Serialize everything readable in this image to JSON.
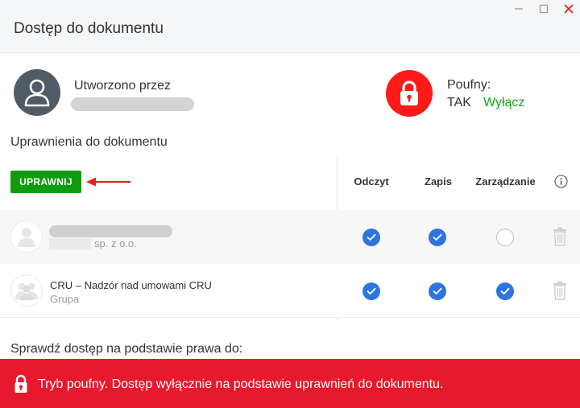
{
  "window": {
    "title": "Dostęp do dokumentu"
  },
  "creator": {
    "label": "Utworzono przez"
  },
  "confidential": {
    "label": "Poufny:",
    "value": "TAK",
    "toggle_label": "Wyłącz"
  },
  "permissions": {
    "section_title": "Uprawnienia do dokumentu",
    "grant_button": "UPRAWNIJ",
    "columns": [
      "Odczyt",
      "Zapis",
      "Zarządzanie"
    ],
    "rows": [
      {
        "subtitle": "sp. z o.o.",
        "read": true,
        "write": true,
        "manage": false
      },
      {
        "name": "CRU – Nadzór nad umowami CRU",
        "subtitle": "Grupa",
        "read": true,
        "write": true,
        "manage": true
      }
    ]
  },
  "check_access": {
    "label": "Sprawdź dostęp na podstawie prawa do:"
  },
  "banner": {
    "text": "Tryb poufny. Dostęp wyłącznie na podstawie uprawnień do dokumentu."
  },
  "colors": {
    "accent_green": "#0f9d0f",
    "lock_red": "#ff1a1a",
    "banner_red": "#e8192c",
    "check_blue": "#2d74e0",
    "avatar_gray": "#505b66"
  },
  "icons": {
    "creator_avatar": "user-icon",
    "confidential": "lock-icon",
    "info": "info-icon",
    "delete": "trash-icon",
    "group_avatar": "group-icon",
    "user_avatar": "user-placeholder-icon",
    "checked": "check-icon"
  }
}
